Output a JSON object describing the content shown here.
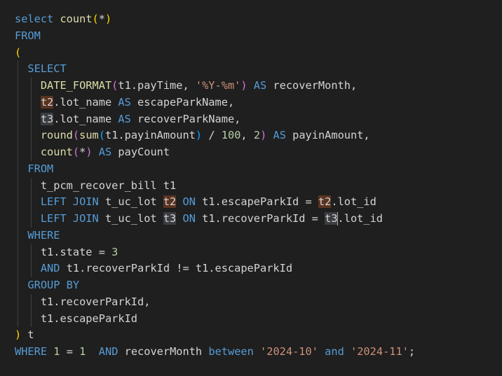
{
  "editor": {
    "lines": [
      [
        {
          "t": "select",
          "c": "kw"
        },
        {
          "t": " count",
          "c": "fn"
        },
        {
          "t": "(",
          "c": "br1"
        },
        {
          "t": "*",
          "c": "id"
        },
        {
          "t": ")",
          "c": "br1"
        }
      ],
      [
        {
          "t": "FROM",
          "c": "kw"
        }
      ],
      [
        {
          "t": "(",
          "c": "br1"
        }
      ],
      [
        {
          "t": "  "
        },
        {
          "t": "SELECT",
          "c": "kw"
        }
      ],
      [
        {
          "t": "    "
        },
        {
          "t": "DATE_FORMAT",
          "c": "fn"
        },
        {
          "t": "(",
          "c": "br2"
        },
        {
          "t": "t1.payTime, ",
          "c": "id"
        },
        {
          "t": "'%Y-%m'",
          "c": "str"
        },
        {
          "t": ")",
          "c": "br2"
        },
        {
          "t": " "
        },
        {
          "t": "AS",
          "c": "kw"
        },
        {
          "t": " recoverMonth,",
          "c": "id"
        }
      ],
      [
        {
          "t": "    "
        },
        {
          "t": "t2",
          "c": "id",
          "hl": "write"
        },
        {
          "t": ".lot_name ",
          "c": "id"
        },
        {
          "t": "AS",
          "c": "kw"
        },
        {
          "t": " escapeParkName,",
          "c": "id"
        }
      ],
      [
        {
          "t": "    "
        },
        {
          "t": "t3",
          "c": "id",
          "hl": "read"
        },
        {
          "t": ".lot_name ",
          "c": "id"
        },
        {
          "t": "AS",
          "c": "kw"
        },
        {
          "t": " recoverParkName,",
          "c": "id"
        }
      ],
      [
        {
          "t": "    "
        },
        {
          "t": "round",
          "c": "fn"
        },
        {
          "t": "(",
          "c": "br2"
        },
        {
          "t": "sum",
          "c": "fn"
        },
        {
          "t": "(",
          "c": "br3"
        },
        {
          "t": "t1.payinAmount",
          "c": "id"
        },
        {
          "t": ")",
          "c": "br3"
        },
        {
          "t": " / ",
          "c": "id"
        },
        {
          "t": "100",
          "c": "num"
        },
        {
          "t": ", ",
          "c": "id"
        },
        {
          "t": "2",
          "c": "num"
        },
        {
          "t": ")",
          "c": "br2"
        },
        {
          "t": " "
        },
        {
          "t": "AS",
          "c": "kw"
        },
        {
          "t": " payinAmount,",
          "c": "id"
        }
      ],
      [
        {
          "t": "    "
        },
        {
          "t": "count",
          "c": "fn"
        },
        {
          "t": "(",
          "c": "br2"
        },
        {
          "t": "*",
          "c": "id"
        },
        {
          "t": ")",
          "c": "br2"
        },
        {
          "t": " "
        },
        {
          "t": "AS",
          "c": "kw"
        },
        {
          "t": " payCount",
          "c": "id"
        }
      ],
      [
        {
          "t": "  "
        },
        {
          "t": "FROM",
          "c": "kw"
        }
      ],
      [
        {
          "t": "    "
        },
        {
          "t": "t_pcm_recover_bill t1",
          "c": "id"
        }
      ],
      [
        {
          "t": "    "
        },
        {
          "t": "LEFT JOIN",
          "c": "kw"
        },
        {
          "t": " t_uc_lot ",
          "c": "id"
        },
        {
          "t": "t2",
          "c": "id",
          "hl": "write"
        },
        {
          "t": " "
        },
        {
          "t": "ON",
          "c": "kw"
        },
        {
          "t": " t1.escapeParkId = ",
          "c": "id"
        },
        {
          "t": "t2",
          "c": "id",
          "hl": "write"
        },
        {
          "t": ".lot_id",
          "c": "id"
        }
      ],
      [
        {
          "t": "    "
        },
        {
          "t": "LEFT JOIN",
          "c": "kw"
        },
        {
          "t": " t_uc_lot ",
          "c": "id"
        },
        {
          "t": "t3",
          "c": "id",
          "hl": "read"
        },
        {
          "t": " "
        },
        {
          "t": "ON",
          "c": "kw"
        },
        {
          "t": " t1.recoverParkId = ",
          "c": "id"
        },
        {
          "t": "t3",
          "c": "id",
          "hl": "read",
          "cursor": true
        },
        {
          "t": ".lot_id",
          "c": "id"
        }
      ],
      [
        {
          "t": "  "
        },
        {
          "t": "WHERE",
          "c": "kw"
        }
      ],
      [
        {
          "t": "    "
        },
        {
          "t": "t1.state = ",
          "c": "id"
        },
        {
          "t": "3",
          "c": "num"
        }
      ],
      [
        {
          "t": "    "
        },
        {
          "t": "AND",
          "c": "kw"
        },
        {
          "t": " t1.recoverParkId != t1.escapeParkId",
          "c": "id"
        }
      ],
      [
        {
          "t": "  "
        },
        {
          "t": "GROUP BY",
          "c": "kw"
        }
      ],
      [
        {
          "t": "    "
        },
        {
          "t": "t1.recoverParkId,",
          "c": "id"
        }
      ],
      [
        {
          "t": "    "
        },
        {
          "t": "t1.escapeParkId",
          "c": "id"
        }
      ],
      [
        {
          "t": ")",
          "c": "br1"
        },
        {
          "t": " t",
          "c": "id"
        }
      ],
      [
        {
          "t": "WHERE",
          "c": "kw"
        },
        {
          "t": " "
        },
        {
          "t": "1",
          "c": "num"
        },
        {
          "t": " = ",
          "c": "id"
        },
        {
          "t": "1",
          "c": "num"
        },
        {
          "t": "  "
        },
        {
          "t": "AND",
          "c": "kw"
        },
        {
          "t": " recoverMonth ",
          "c": "id"
        },
        {
          "t": "between",
          "c": "kw"
        },
        {
          "t": " "
        },
        {
          "t": "'2024-10'",
          "c": "str"
        },
        {
          "t": " "
        },
        {
          "t": "and",
          "c": "kw"
        },
        {
          "t": " "
        },
        {
          "t": "'2024-11'",
          "c": "str"
        },
        {
          "t": ";",
          "c": "id"
        }
      ]
    ]
  }
}
